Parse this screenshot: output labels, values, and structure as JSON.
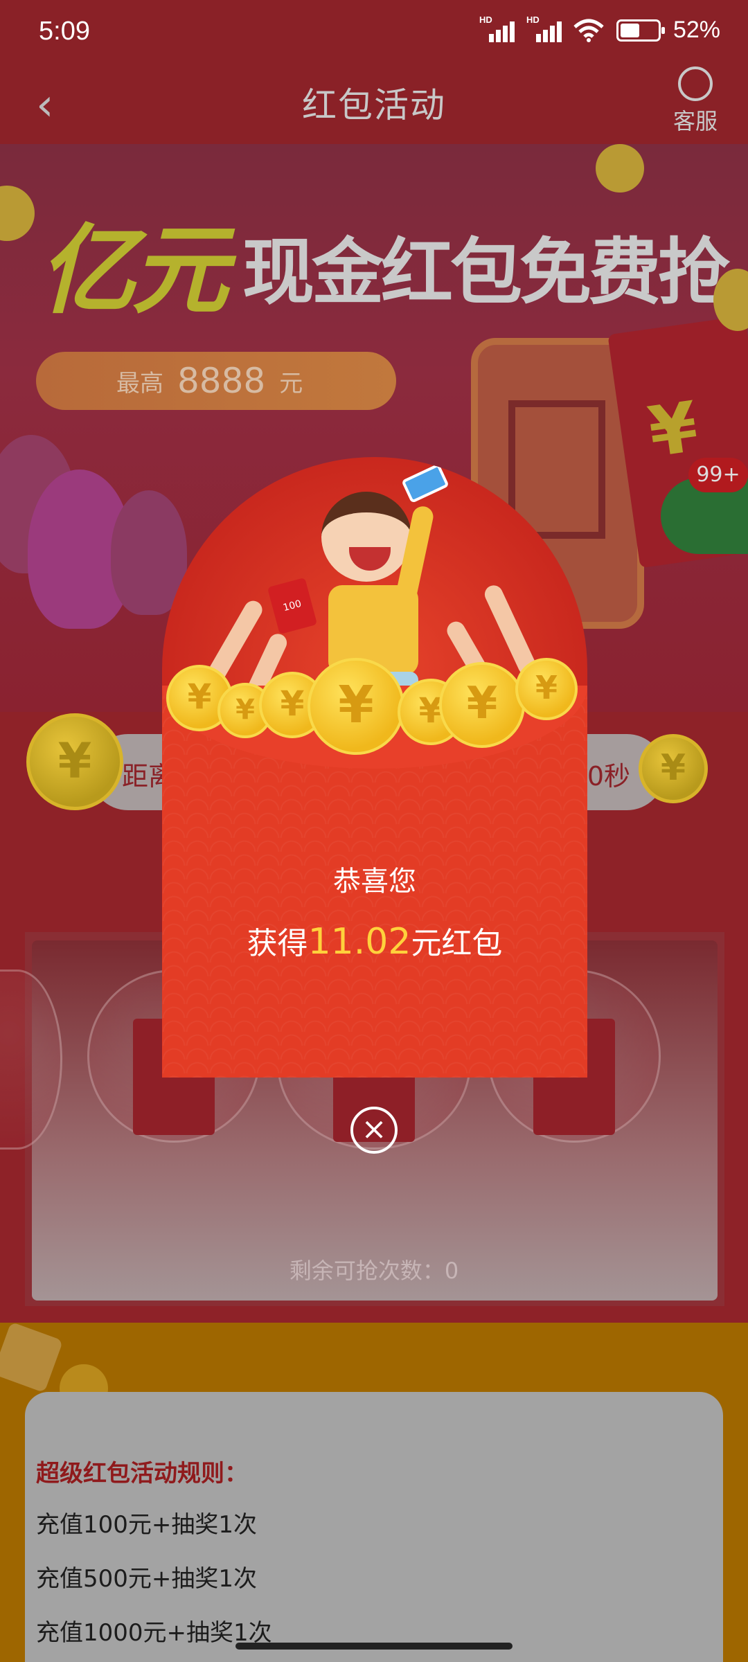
{
  "status_bar": {
    "time": "5:09",
    "battery_percent": "52%",
    "network_label": "HD",
    "battery_level": 0.52
  },
  "nav": {
    "title": "红包活动",
    "back_icon": "chevron-left-icon",
    "service_label": "客服",
    "service_icon": "headset-icon"
  },
  "banner": {
    "headline_highlight": "亿元",
    "headline_rest": "现金红包免费抢",
    "max_prefix": "最高",
    "max_amount": "8888",
    "max_suffix": "元"
  },
  "floating": {
    "badge": "99+",
    "chat_icon": "wechat-icon"
  },
  "countdown": {
    "left_text": "距离",
    "right_text": "0秒"
  },
  "grab": {
    "remaining_label": "剩余可抢次数：0"
  },
  "rules": {
    "title": "超级红包活动规则：",
    "lines": [
      "充值100元+抽奖1次",
      "充值500元+抽奖1次",
      "充值1000元+抽奖1次"
    ]
  },
  "modal": {
    "congrats": "恭喜您",
    "got_prefix": "获得",
    "amount": "11.02",
    "got_suffix": "元红包",
    "pouch_label": "100",
    "close_icon": "close-circle-icon"
  },
  "colors": {
    "accent_red": "#e33c25",
    "gold": "#ffd23c",
    "header_bg": "#8a2127"
  }
}
